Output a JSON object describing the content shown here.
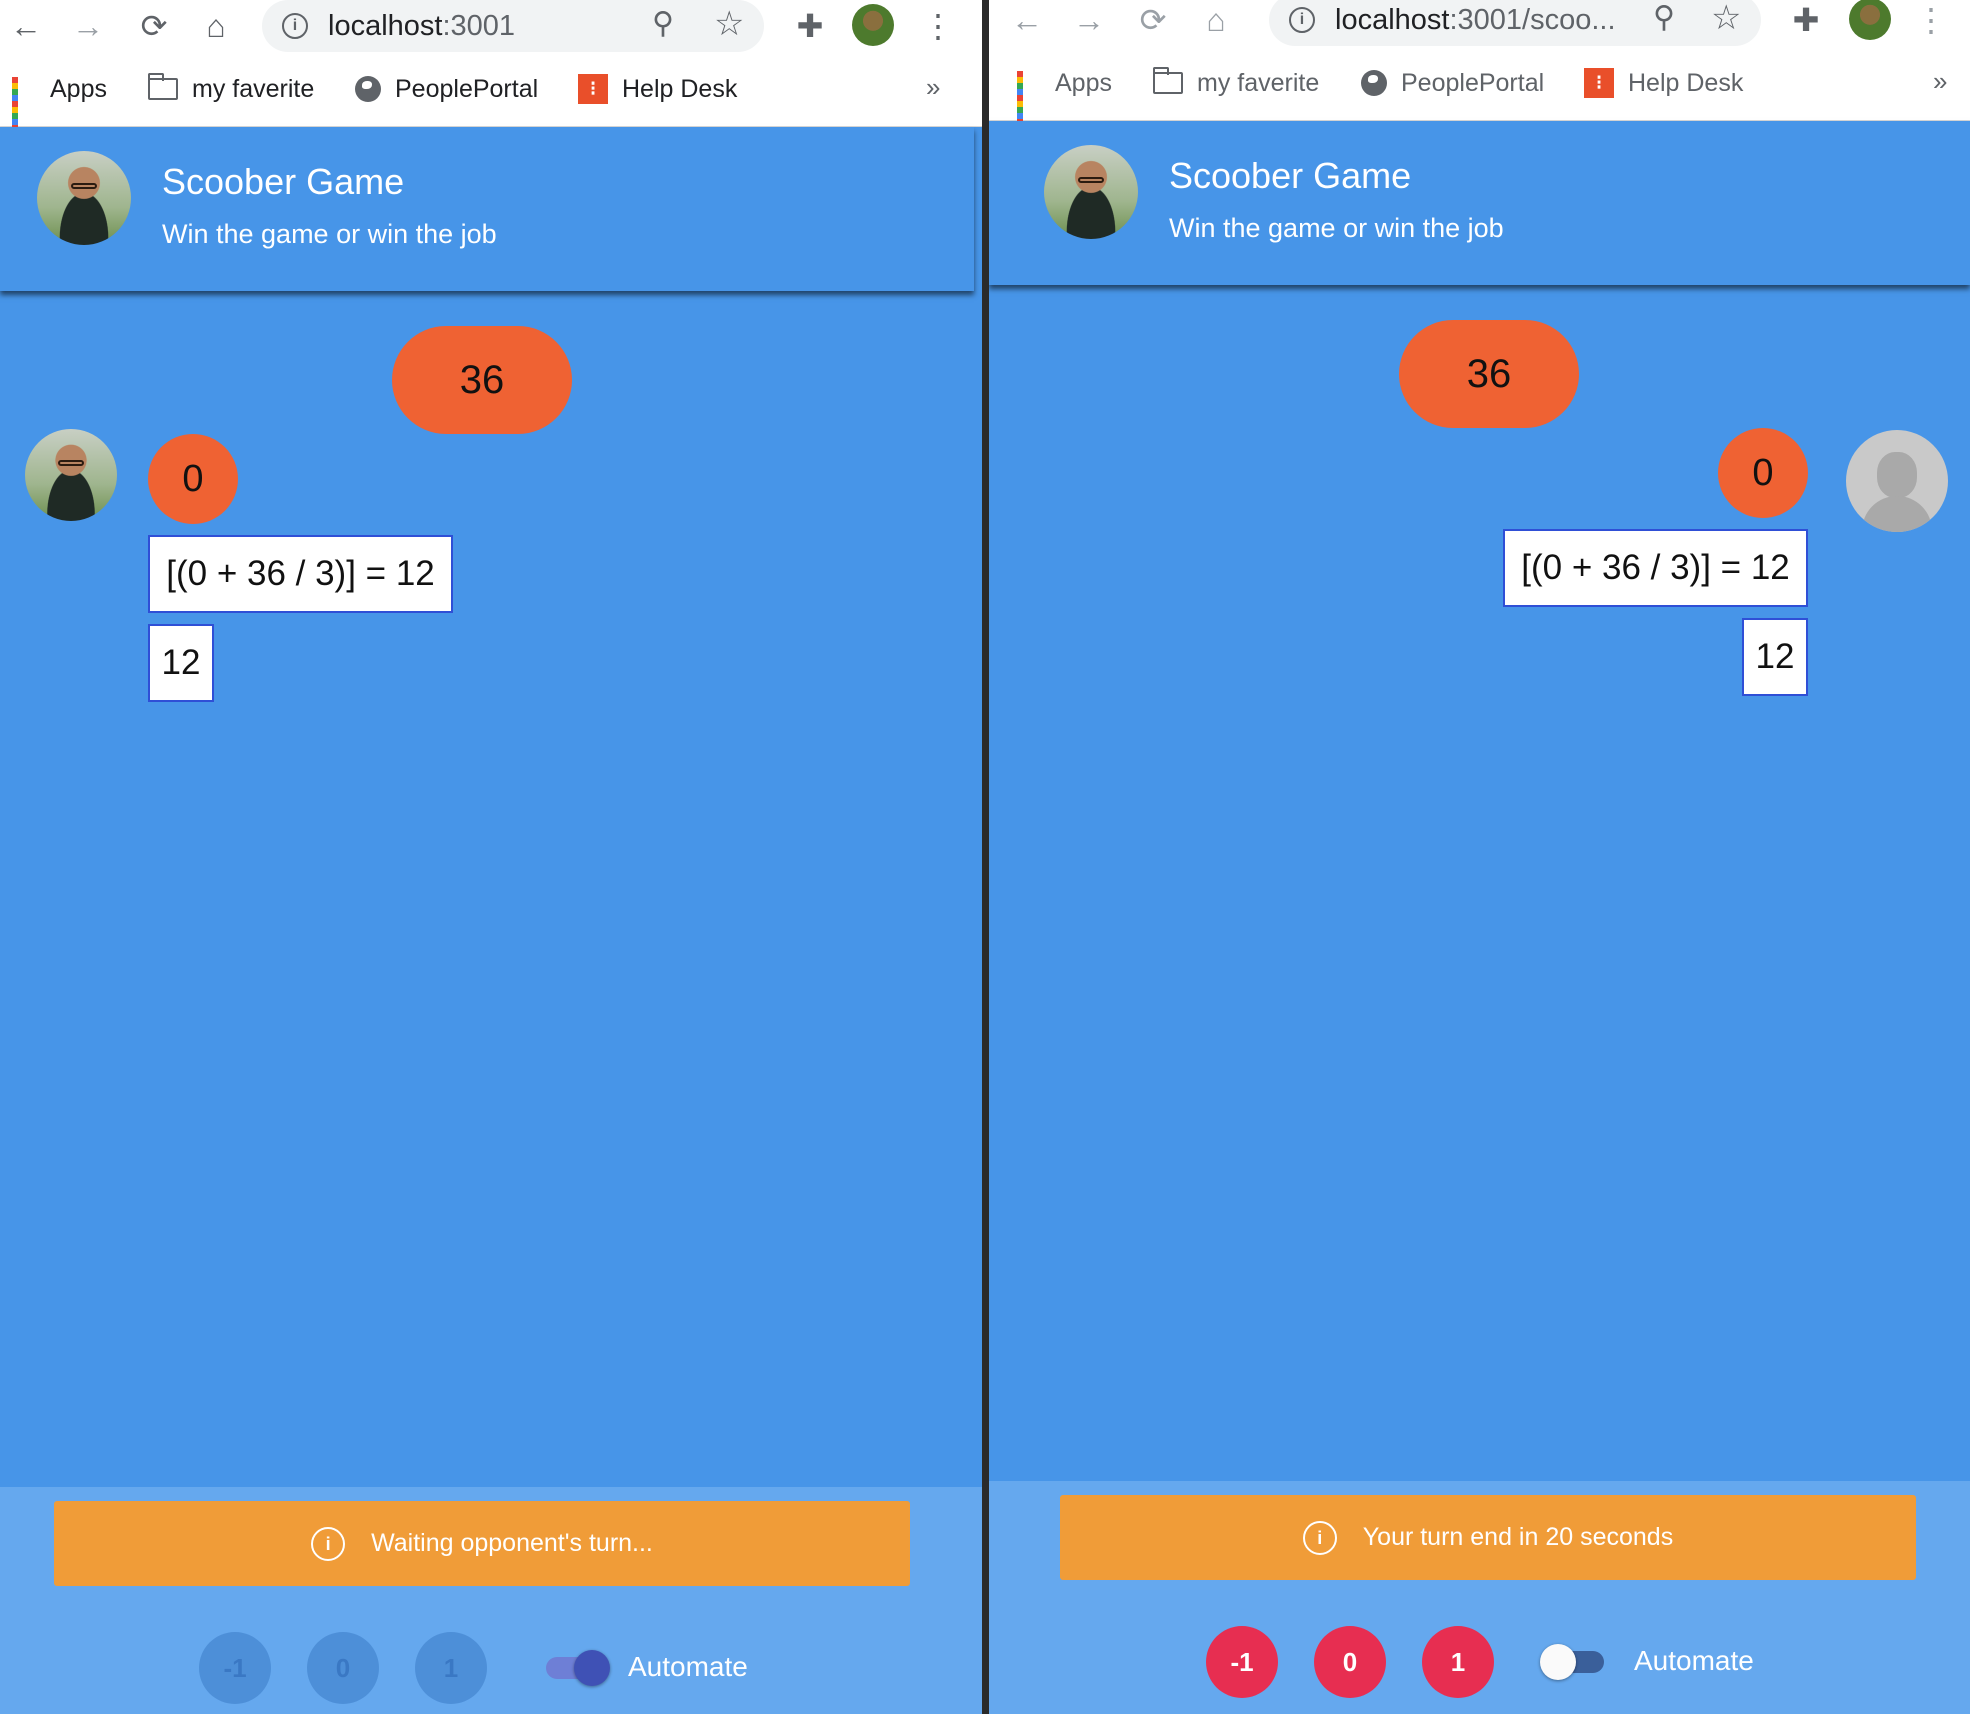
{
  "browser": {
    "left_url_host": "localhost",
    "left_url_port": ":3001",
    "right_url_host": "localhost",
    "right_url_rest": ":3001/scoo...",
    "nav_back": "←",
    "nav_forward": "→",
    "nav_reload": "⟳",
    "nav_home": "⌂",
    "zoom_icon": "⚲",
    "star_icon": "☆",
    "extensions_icon": "✚",
    "menu_icon": "⋮",
    "bookmarks": [
      {
        "label": "Apps"
      },
      {
        "label": "my faverite"
      },
      {
        "label": "PeoplePortal"
      },
      {
        "label": "Help Desk"
      }
    ],
    "overflow": "»"
  },
  "app": {
    "title": "Scoober Game",
    "subtitle": "Win the game or win the job",
    "brand_color": "#4795e8"
  },
  "game": {
    "target_number": "36",
    "left_player": {
      "score": "0",
      "formula": "[(0 + 36 / 3)] = 12",
      "result": "12"
    },
    "right_player": {
      "score": "0",
      "formula": "[(0 + 36 / 3)] = 12",
      "result": "12"
    }
  },
  "left_footer": {
    "status": "Waiting opponent's turn...",
    "buttons": [
      "-1",
      "0",
      "1"
    ],
    "buttons_enabled": false,
    "automate_label": "Automate",
    "automate_on": true
  },
  "right_footer": {
    "status": "Your turn end in 20 seconds",
    "buttons": [
      "-1",
      "0",
      "1"
    ],
    "buttons_enabled": true,
    "automate_label": "Automate",
    "automate_on": false
  },
  "colors": {
    "accent_orange": "#ef6233",
    "banner": "#f09c38",
    "button_active": "#e72e51",
    "switch_on": "#3f51b5"
  }
}
